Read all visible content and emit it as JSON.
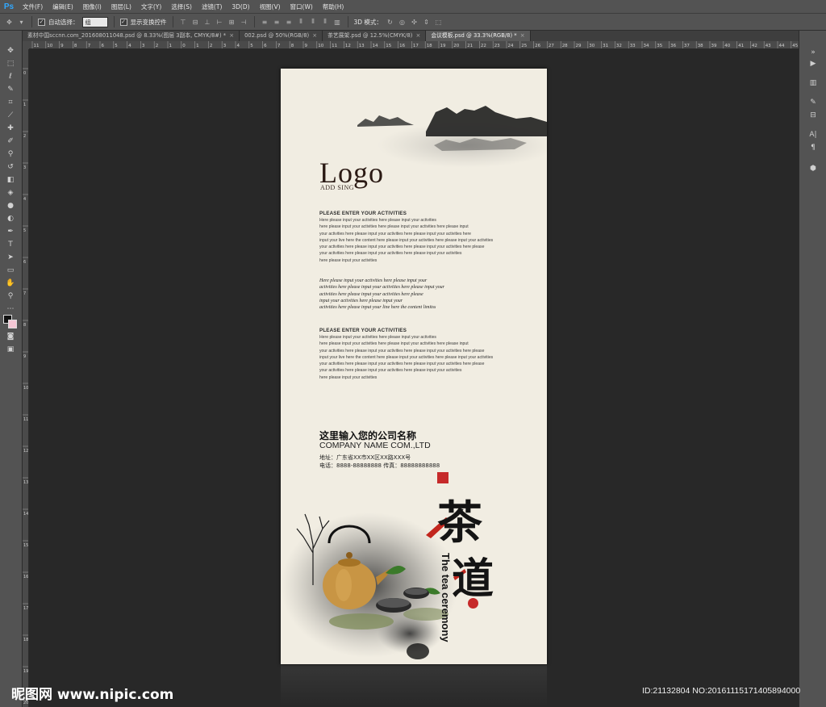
{
  "menubar": {
    "app_logo": "Ps",
    "items": [
      "文件(F)",
      "编辑(E)",
      "图像(I)",
      "图层(L)",
      "文字(Y)",
      "选择(S)",
      "滤镜(T)",
      "3D(D)",
      "视图(V)",
      "窗口(W)",
      "帮助(H)"
    ]
  },
  "options": {
    "auto_select_label": "自动选择：",
    "auto_select_value": "组",
    "show_transform_label": "显示变换控件",
    "mode_3d_label": "3D 模式："
  },
  "tabs": [
    {
      "label": "素材中国sccnn.com_201608011048.psd @ 8.33%(图层 3副本, CMYK/8#) *",
      "active": false
    },
    {
      "label": "002.psd @ 50%(RGB/8)",
      "active": false
    },
    {
      "label": "茶艺展架.psd @ 12.5%(CMYK/8)",
      "active": false
    },
    {
      "label": "会议模板.psd @ 33.3%(RGB/8) *",
      "active": true
    }
  ],
  "ruler": {
    "h_ticks": [
      "11",
      "10",
      "9",
      "8",
      "7",
      "6",
      "5",
      "4",
      "3",
      "2",
      "1",
      "0",
      "1",
      "2",
      "3",
      "4",
      "5",
      "6",
      "7",
      "8",
      "9",
      "10",
      "11",
      "12",
      "13",
      "14",
      "15",
      "16",
      "17",
      "18",
      "19",
      "20",
      "21",
      "22",
      "23",
      "24",
      "25",
      "26",
      "27",
      "28",
      "29",
      "30",
      "31",
      "32",
      "33",
      "34",
      "35",
      "36",
      "37",
      "38",
      "39",
      "40",
      "41",
      "42",
      "43",
      "44",
      "45"
    ],
    "v_ticks": [
      "0",
      "1",
      "2",
      "3",
      "4",
      "5",
      "6",
      "7",
      "8",
      "9",
      "10",
      "11",
      "12",
      "13",
      "14",
      "15",
      "16",
      "17",
      "18",
      "19",
      "20"
    ]
  },
  "document": {
    "logo": "Logo",
    "logo_sub": "ADD SING",
    "section1": {
      "heading": "PLEASE ENTER YOUR ACTIVITIES",
      "lines": [
        "Here please input your activities here please input your activities",
        "here please input your activities here please input your activities here please input",
        "your activities here please input your activities here please input your activities here",
        "input your live here the content here please input your activities here please input your activities",
        "your activities here please input your activities here please input your activities here please",
        "your activities here please input your activities here please input your activities",
        "here please input your activities"
      ]
    },
    "script_block": [
      "Here please input your activities here please input your",
      "activities here please input your activities here please input your",
      "activities here please input your activities here please",
      "input your activities here please input your",
      "activities here please input your line here the content limitss"
    ],
    "section2": {
      "heading": "PLEASE ENTER YOUR ACTIVITIES",
      "lines": [
        "Here please input your activities here please input your activities",
        "here please input your activities here please input your activities here please input",
        "your activities here please input your activities here please input your activities here please",
        "input your live here the content here please input your activities here please input your activities",
        "your activities here please input your activities here please input your activities here please",
        "your activities here please input your activities here please input your activities",
        "here please input your activities"
      ]
    },
    "company_cn": "这里输入您的公司名称",
    "company_en": "COMPANY NAME COM.,LTD",
    "address": "地址：广东省XX市XX区XX路XXX号",
    "phone": "电话：8888-88888888  传真：88888888888",
    "title_char1": "茶",
    "title_char2": "道",
    "title_en": "The tea ceremony"
  },
  "watermark": {
    "left": "昵图网 www.nipic.com",
    "right": "ID:21132804 NO:20161115171405894000"
  },
  "colors": {
    "chrome": "#535353",
    "canvas_bg": "#282828",
    "paper": "#f1ede2",
    "seal_red": "#c62a2a",
    "ps_blue": "#31a8ff"
  }
}
